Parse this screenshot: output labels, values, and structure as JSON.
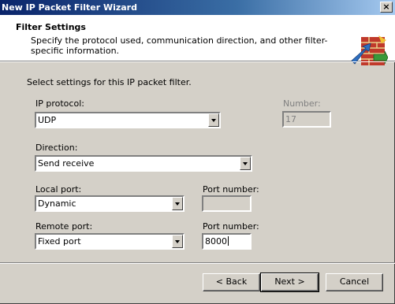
{
  "window": {
    "title": "New IP Packet Filter Wizard",
    "close_glyph": "×"
  },
  "header": {
    "title": "Filter Settings",
    "description": "Specify the protocol used, communication direction, and other filter-specific information.",
    "icon": "wizard-firewall-icon"
  },
  "body": {
    "intro": "Select settings for this IP packet filter.",
    "ip_protocol": {
      "label": "IP protocol:",
      "value": "UDP"
    },
    "number": {
      "label": "Number:",
      "value": "17"
    },
    "direction": {
      "label": "Direction:",
      "value": "Send receive"
    },
    "local_port": {
      "label": "Local port:",
      "value": "Dynamic"
    },
    "local_port_number": {
      "label": "Port number:",
      "value": ""
    },
    "remote_port": {
      "label": "Remote port:",
      "value": "Fixed port"
    },
    "remote_port_number": {
      "label": "Port number:",
      "value": "8000"
    }
  },
  "buttons": {
    "back": "< Back",
    "next": "Next >",
    "cancel": "Cancel"
  }
}
